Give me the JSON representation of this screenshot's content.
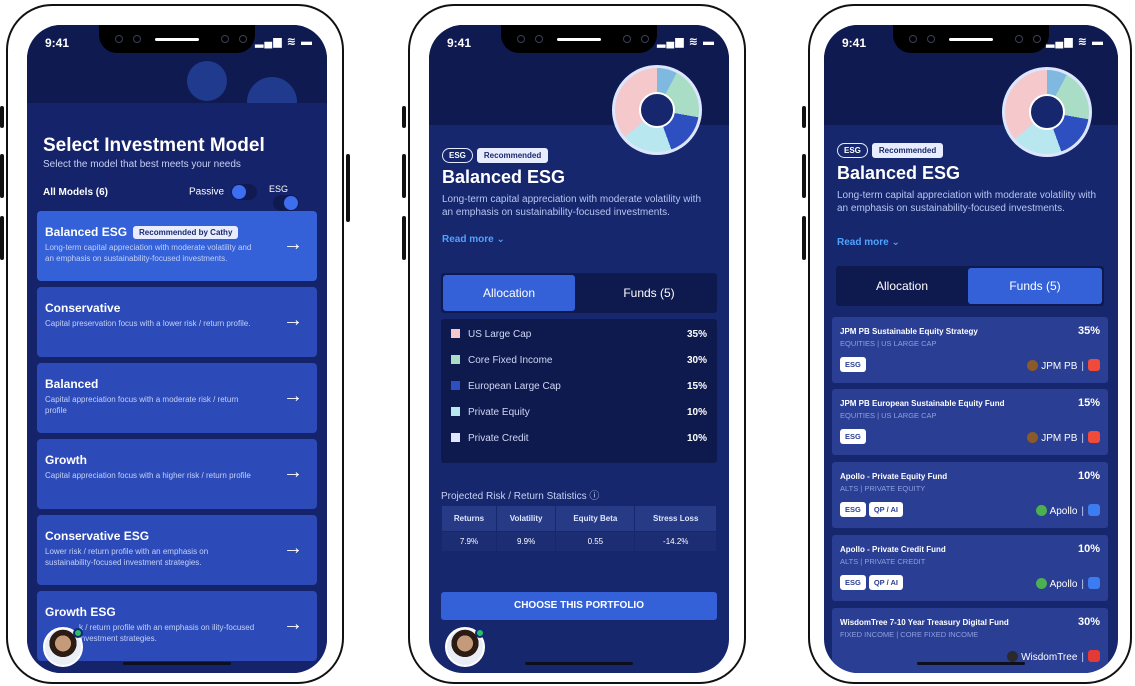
{
  "colors": {
    "screen_bg": "#16276e",
    "card": "#2c4bb8",
    "accent": "#3461d8",
    "link": "#4fa3ff"
  },
  "status_bar": {
    "time": "9:41",
    "icons": "signal-wifi-battery"
  },
  "screen1": {
    "title": "Select Investment Model",
    "subtitle": "Select the model that best meets your needs",
    "filter_label": "All Models (6)",
    "toggle_passive": "Passive",
    "toggle_esg": "ESG",
    "models": [
      {
        "name": "Balanced ESG",
        "badge": "Recommended by Cathy",
        "desc": "Long-term capital appreciation with moderate volatility and an emphasis on sustainability-focused investments."
      },
      {
        "name": "Conservative",
        "badge": "",
        "desc": "Capital preservation focus with a lower risk / return profile."
      },
      {
        "name": "Balanced",
        "badge": "",
        "desc": "Capital appreciation focus with a moderate risk / return profile"
      },
      {
        "name": "Growth",
        "badge": "",
        "desc": "Capital appreciation focus with a higher risk / return profile"
      },
      {
        "name": "Conservative ESG",
        "badge": "",
        "desc": "Lower risk / return profile with an emphasis on sustainability-focused investment strategies."
      },
      {
        "name": "Growth ESG",
        "badge": "",
        "desc": "k / return profile with an emphasis on ility-focused investment strategies."
      }
    ]
  },
  "detail": {
    "tag_esg": "ESG",
    "tag_recommended": "Recommended",
    "title": "Balanced ESG",
    "desc": "Long-term capital appreciation with moderate volatility with an emphasis on sustainability-focused investments.",
    "read_more": "Read more ⌄",
    "tab_allocation": "Allocation",
    "tab_funds": "Funds (5)"
  },
  "screen2": {
    "allocation": [
      {
        "label": "US Large Cap",
        "pct": "35%",
        "color": "#f5c9cc"
      },
      {
        "label": "Core Fixed Income",
        "pct": "30%",
        "color": "#a9ddc6"
      },
      {
        "label": "European Large Cap",
        "pct": "15%",
        "color": "#2e4fbf"
      },
      {
        "label": "Private Equity",
        "pct": "10%",
        "color": "#b8e7ef"
      },
      {
        "label": "Private Credit",
        "pct": "10%",
        "color": "#dfe7ff"
      }
    ],
    "proj_title": "Projected Risk / Return Statistics ⓘ",
    "stats_headers": [
      "Returns",
      "Volatility",
      "Equity Beta",
      "Stress Loss"
    ],
    "stats_values": [
      "7.9%",
      "9.9%",
      "0.55",
      "-14.2%"
    ],
    "cta": "CHOOSE THIS PORTFOLIO"
  },
  "screen3": {
    "funds": [
      {
        "name": "JPM PB Sustainable Equity Strategy",
        "sub": "EQUITIES | US LARGE CAP",
        "pct": "35%",
        "chips": [
          "ESG"
        ],
        "manager": "JPM PB",
        "logo_color": "#8a5a2b",
        "ext_color": "#f04a3a"
      },
      {
        "name": "JPM PB European Sustainable Equity Fund",
        "sub": "EQUITIES | US LARGE CAP",
        "pct": "15%",
        "chips": [
          "ESG"
        ],
        "manager": "JPM PB",
        "logo_color": "#8a5a2b",
        "ext_color": "#f04a3a"
      },
      {
        "name": "Apollo - Private Equity Fund",
        "sub": "ALTS | PRIVATE EQUITY",
        "pct": "10%",
        "chips": [
          "ESG",
          "QP / AI"
        ],
        "manager": "Apollo",
        "logo_color": "#4caf50",
        "ext_color": "#3c7bf0"
      },
      {
        "name": "Apollo - Private Credit Fund",
        "sub": "ALTS | PRIVATE CREDIT",
        "pct": "10%",
        "chips": [
          "ESG",
          "QP / AI"
        ],
        "manager": "Apollo",
        "logo_color": "#4caf50",
        "ext_color": "#3c7bf0"
      },
      {
        "name": "WisdomTree 7-10 Year Treasury Digital Fund",
        "sub": "FIXED INCOME | CORE FIXED INCOME",
        "pct": "30%",
        "chips": [],
        "manager": "WisdomTree",
        "logo_color": "#2a2a2a",
        "ext_color": "#e53935"
      }
    ]
  }
}
